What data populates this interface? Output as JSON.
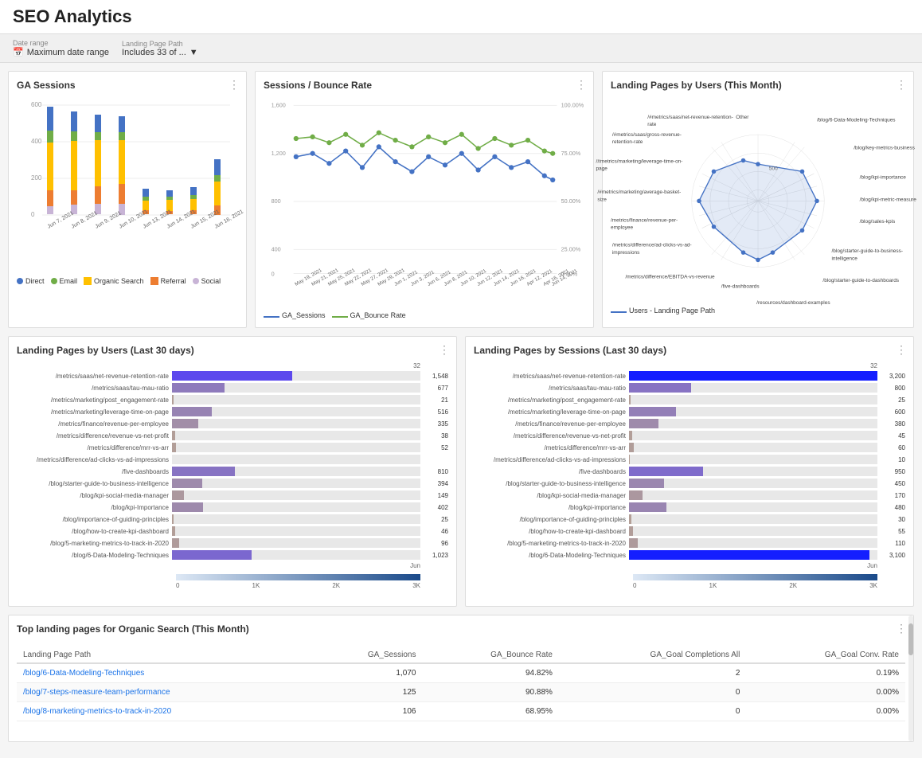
{
  "header": {
    "title": "SEO Analytics"
  },
  "filters": {
    "date_range_label": "Date range",
    "date_range_value": "Maximum date range",
    "landing_page_label": "Landing Page Path",
    "landing_page_value": "Includes 33 of ..."
  },
  "ga_sessions": {
    "title": "GA Sessions",
    "y_labels": [
      "600",
      "400",
      "200",
      "0"
    ],
    "x_labels": [
      "Jun 7, 2021",
      "Jun 8, 2021",
      "Jun 9, 2021",
      "Jun 10, 2021",
      "Jun 13, 2021",
      "Jun 14, 2021",
      "Jun 15, 2021",
      "Jun 16, 2021"
    ],
    "legend": [
      {
        "label": "Direct",
        "color": "#4472c4"
      },
      {
        "label": "Email",
        "color": "#70ad47"
      },
      {
        "label": "Organic Search",
        "color": "#ffc000"
      },
      {
        "label": "Referral",
        "color": "#ed7d31"
      },
      {
        "label": "Social",
        "color": "#c8b4d6"
      }
    ]
  },
  "sessions_bounce": {
    "title": "Sessions / Bounce Rate",
    "legend": [
      {
        "label": "GA_Sessions",
        "color": "#4472c4"
      },
      {
        "label": "GA_Bounce Rate",
        "color": "#70ad47"
      }
    ]
  },
  "landing_radar": {
    "title": "Landing Pages by Users (This Month)",
    "legend_label": "Users - Landing Page Path",
    "labels": [
      "Other",
      "/blog/6-Data-Modeling-Techniques",
      "/blog/key-metrics-business",
      "/blog/kpi-importance",
      "/blog/kpi-metric-measure",
      "/blog/sales-kpis",
      "/blog/starter-guide-to-business-intelligence",
      "/blog/starter-guide-to-dashboards",
      "/five-dashboards",
      "/metrics/difference/EBITDA-vs-revenue",
      "/metrics/difference/ad-clicks-vs-ad-impressions",
      "/metrics/finance/revenue-per-employee",
      "/#metrics/marketing/average-basket-size",
      "/#metrics/marketing/leverage-time-on-page",
      "/#metrics/saas/gross-revenue-retention-rate",
      "/#metrics/saas/net-revenue-retention-rate",
      "/resources/dashboard-examples"
    ]
  },
  "landing_users_30": {
    "title": "Landing Pages by Users (Last 30 days)",
    "rows": [
      {
        "label": "/metrics/saas/net-revenue-retention-rate",
        "value": 1548
      },
      {
        "label": "/metrics/saas/tau-mau-ratio",
        "value": 677
      },
      {
        "label": "/metrics/marketing/post_engagement-rate",
        "value": 21
      },
      {
        "label": "/metrics/marketing/leverage-time-on-page",
        "value": 516
      },
      {
        "label": "/metrics/finance/revenue-per-employee",
        "value": 335
      },
      {
        "label": "/metrics/difference/revenue-vs-net-profit",
        "value": 38
      },
      {
        "label": "/metrics/difference/mrr-vs-arr",
        "value": 52
      },
      {
        "label": "/metrics/difference/ad-clicks-vs-ad-impressions",
        "value": 0
      },
      {
        "label": "/five-dashboards",
        "value": 810
      },
      {
        "label": "/blog/starter-guide-to-business-intelligence",
        "value": 394
      },
      {
        "label": "/blog/kpi-social-media-manager",
        "value": 149
      },
      {
        "label": "/blog/kpi-Importance",
        "value": 402
      },
      {
        "label": "/blog/importance-of-guiding-principles",
        "value": 25
      },
      {
        "label": "/blog/how-to-create-kpi-dashboard",
        "value": 46
      },
      {
        "label": "/blog/5-marketing-metrics-to-track-in-2020",
        "value": 96
      },
      {
        "label": "/blog/6-Data-Modeling-Techniques",
        "value": 1023
      }
    ],
    "max_value": 3200,
    "scale_labels": [
      "0",
      "1K",
      "2K",
      "3K"
    ]
  },
  "landing_sessions_30": {
    "title": "Landing Pages by Sessions (Last 30 days)",
    "rows": [
      {
        "label": "/metrics/saas/net-revenue-retention-rate",
        "value": 3200
      },
      {
        "label": "/metrics/saas/tau-mau-ratio",
        "value": 800
      },
      {
        "label": "/metrics/marketing/post_engagement-rate",
        "value": 25
      },
      {
        "label": "/metrics/marketing/leverage-time-on-page",
        "value": 600
      },
      {
        "label": "/metrics/finance/revenue-per-employee",
        "value": 380
      },
      {
        "label": "/metrics/difference/revenue-vs-net-profit",
        "value": 45
      },
      {
        "label": "/metrics/difference/mrr-vs-arr",
        "value": 60
      },
      {
        "label": "/metrics/difference/ad-clicks-vs-ad-impressions",
        "value": 10
      },
      {
        "label": "/five-dashboards",
        "value": 950
      },
      {
        "label": "/blog/starter-guide-to-business-intelligence",
        "value": 450
      },
      {
        "label": "/blog/kpi-social-media-manager",
        "value": 170
      },
      {
        "label": "/blog/kpi-importance",
        "value": 480
      },
      {
        "label": "/blog/importance-of-guiding-principles",
        "value": 30
      },
      {
        "label": "/blog/how-to-create-kpi-dashboard",
        "value": 55
      },
      {
        "label": "/blog/5-marketing-metrics-to-track-in-2020",
        "value": 110
      },
      {
        "label": "/blog/6-Data-Modeling-Techniques",
        "value": 3100
      }
    ],
    "max_value": 3200,
    "scale_labels": [
      "0",
      "1K",
      "2K",
      "3K"
    ]
  },
  "top_landing_pages": {
    "title": "Top landing pages for Organic Search (This Month)",
    "columns": [
      "Landing Page Path",
      "GA_Sessions",
      "GA_Bounce Rate",
      "GA_Goal Completions All",
      "GA_Goal Conv. Rate"
    ],
    "rows": [
      {
        "path": "/blog/6-Data-Modeling-Techniques",
        "sessions": "1,070",
        "bounce_rate": "94.82%",
        "goal_completions": "2",
        "conv_rate": "0.19%"
      },
      {
        "path": "/blog/7-steps-measure-team-performance",
        "sessions": "125",
        "bounce_rate": "90.88%",
        "goal_completions": "0",
        "conv_rate": "0.00%"
      },
      {
        "path": "/blog/8-marketing-metrics-to-track-in-2020",
        "sessions": "106",
        "bounce_rate": "68.95%",
        "goal_completions": "0",
        "conv_rate": "0.00%"
      }
    ]
  }
}
